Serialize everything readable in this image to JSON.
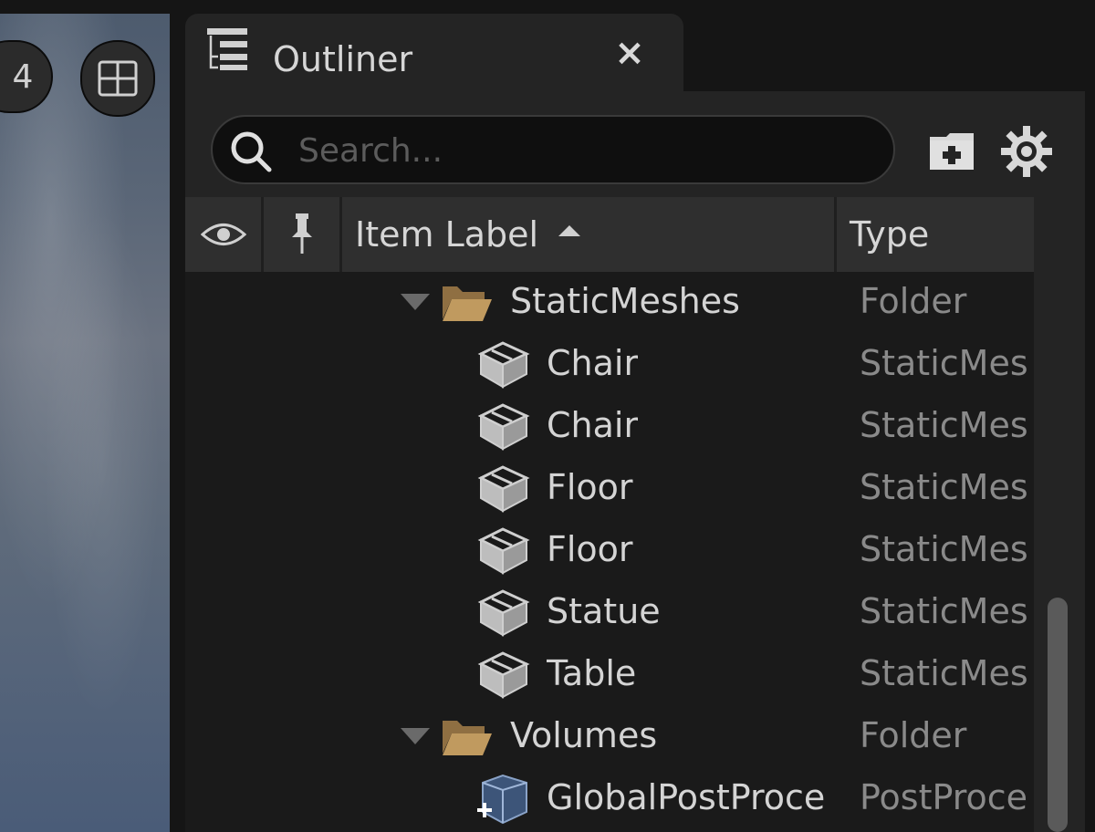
{
  "viewport": {
    "view_number": "4"
  },
  "panel": {
    "title": "Outliner",
    "close_label": "×",
    "search": {
      "placeholder": "Search..."
    },
    "columns": {
      "label": "Item Label",
      "type": "Type"
    }
  },
  "rows": [
    {
      "label": "StaticMeshes",
      "type": "Folder"
    },
    {
      "label": "Chair",
      "type": "StaticMes"
    },
    {
      "label": "Chair",
      "type": "StaticMes"
    },
    {
      "label": "Floor",
      "type": "StaticMes"
    },
    {
      "label": "Floor",
      "type": "StaticMes"
    },
    {
      "label": "Statue",
      "type": "StaticMes"
    },
    {
      "label": "Table",
      "type": "StaticMes"
    },
    {
      "label": "Volumes",
      "type": "Folder"
    },
    {
      "label": "GlobalPostProce",
      "type": "PostProce"
    }
  ],
  "colors": {
    "folder": "#b8915a",
    "panel_bg": "#242424",
    "row_bg": "#1a1a1a"
  },
  "icons": {
    "tab": "outliner-icon",
    "folder": "folder-open-icon",
    "mesh": "static-mesh-icon",
    "volume": "post-process-volume-icon"
  }
}
